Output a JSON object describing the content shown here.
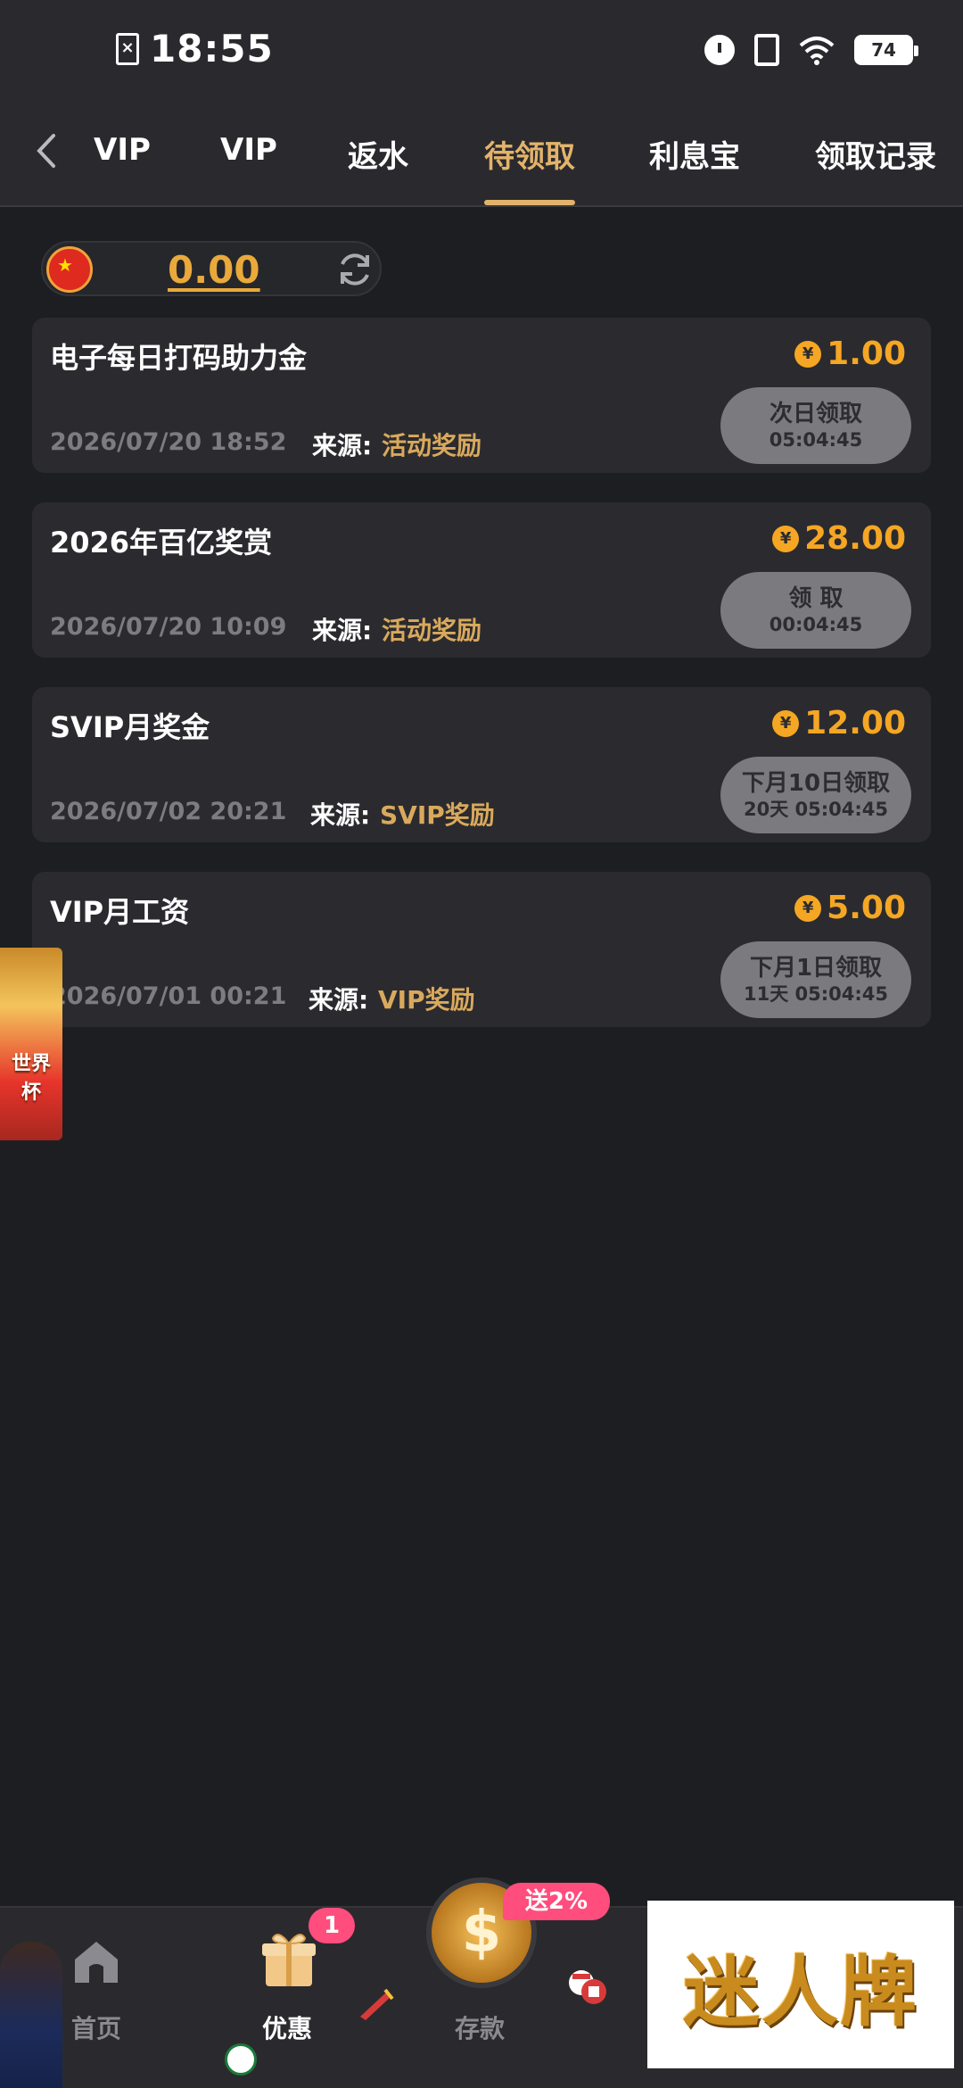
{
  "status_bar": {
    "time": "18:55",
    "battery": "74"
  },
  "tabs": [
    {
      "label": "VIP"
    },
    {
      "label": "VIP"
    },
    {
      "label": "返水"
    },
    {
      "label": "待领取"
    },
    {
      "label": "利息宝"
    },
    {
      "label": "领取记录"
    }
  ],
  "active_tab": "待领取",
  "balance": {
    "value": "0.00"
  },
  "currency_symbol": "¥",
  "source_label": "来源:",
  "rewards": [
    {
      "title": "电子每日打码助力金",
      "amount": "1.00",
      "date": "2026/07/20 18:52",
      "source": "活动奖励",
      "button_label": "次日领取",
      "button_time": "05:04:45"
    },
    {
      "title": "2026年百亿奖赏",
      "amount": "28.00",
      "date": "2026/07/20 10:09",
      "source": "活动奖励",
      "button_label": "领 取",
      "button_time": "00:04:45"
    },
    {
      "title": "SVIP月奖金",
      "amount": "12.00",
      "date": "2026/07/02 20:21",
      "source": "SVIP奖励",
      "button_label": "下月10日领取",
      "button_time": "20天 05:04:45"
    },
    {
      "title": "VIP月工资",
      "amount": "5.00",
      "date": "2026/07/01 00:21",
      "source": "VIP奖励",
      "button_label": "下月1日领取",
      "button_time": "11天 05:04:45"
    }
  ],
  "side_banner": {
    "text": "世界杯"
  },
  "bottom_nav": {
    "home": "首页",
    "promos": "优惠",
    "promos_badge": "1",
    "deposit": "存款",
    "deposit_tag": "送2%"
  },
  "watermark": "迷人牌",
  "colors": {
    "accent": "#e3b36b",
    "amount": "#f5a623",
    "source": "#d9a95c",
    "background": "#1d1e22",
    "card": "#2b2b2f",
    "badge": "#ff4d7d"
  }
}
